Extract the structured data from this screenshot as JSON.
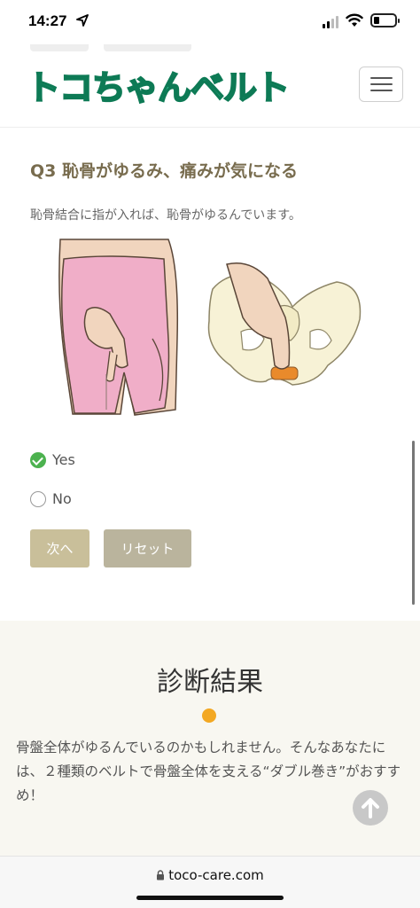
{
  "status": {
    "time": "14:27"
  },
  "header": {
    "logo": "トコちゃんベルト"
  },
  "question": {
    "title": "Q3 恥骨がゆるみ、痛みが気になる",
    "description": "恥骨結合に指が入れば、恥骨がゆるんでいます。",
    "options": [
      {
        "label": "Yes",
        "selected": true
      },
      {
        "label": "No",
        "selected": false
      }
    ],
    "next_label": "次へ",
    "reset_label": "リセット"
  },
  "result": {
    "title": "診断結果",
    "text": "骨盤全体がゆるんでいるのかもしれません。そんなあなたには、２種類のベルトで骨盤全体を支える“ダブル巻き”がおすすめ！"
  },
  "browser": {
    "url": "toco-care.com"
  },
  "colors": {
    "brand_green": "#2dbb8e",
    "question_title": "#786c4e",
    "check_green": "#4cb24f",
    "button_next": "#c9bf9a",
    "button_reset": "#bab49d",
    "accent_dot": "#f3a823",
    "result_bg": "#f8f7f1"
  }
}
